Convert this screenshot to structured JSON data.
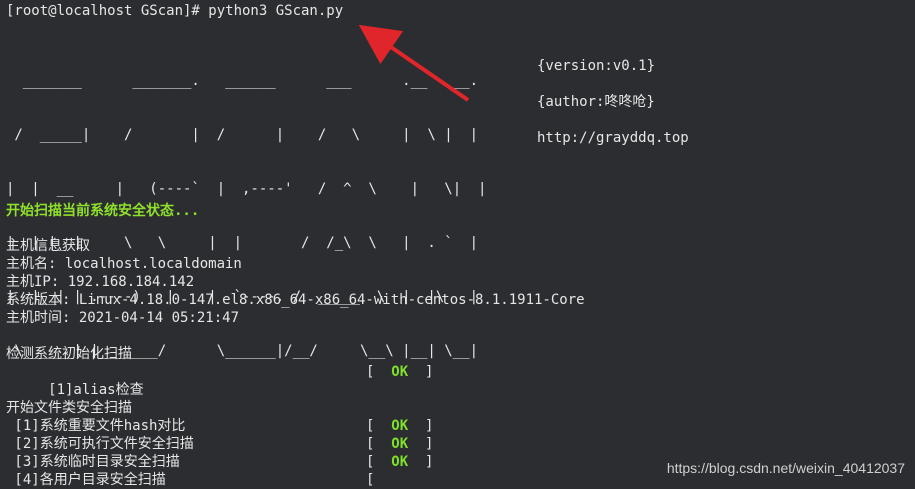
{
  "terminal": {
    "prompt": "[root@localhost GScan]# python3 GScan.py",
    "ascii_art": [
      "  _______      _______.   ______      ___      .__   __. ",
      " /  _____|    /       |  /      |    /   \\     |  \\ |  | ",
      "|  |  __     |   (----`  |  ,----'   /  ^  \\    |   \\|  | ",
      "|  | |_ |     \\   \\     |  |       /  /_\\  \\   |  . `  | ",
      "|  |__| | .----)   |    |  `----. /  _____  \\  |  |\\   | ",
      " \\______| |_______/      \\______|/__/     \\__\\ |__| \\__| "
    ],
    "version": "{version:v0.1}",
    "author": "{author:咚咚呛}",
    "website": "http://grayddq.top",
    "start_message": "开始扫描当前系统安全状态...",
    "host_section_title": "主机信息获取",
    "host_name_line": "主机名: localhost.localdomain",
    "host_ip_line": "主机IP: 192.168.184.142",
    "os_version_line": "系统版本: Linux-4.18.0-147.el8.x86_64-x86_64-with-centos-8.1.1911-Core",
    "host_time_line": "主机时间: 2021-04-14 05:21:47",
    "init_section_title": "检测系统初始化扫描",
    "init_items": [
      {
        "label": " [1]alias检查",
        "status": "OK"
      }
    ],
    "file_section_title": "开始文件类安全扫描",
    "file_items": [
      {
        "label": " [1]系统重要文件hash对比",
        "status": "OK"
      },
      {
        "label": " [2]系统可执行文件安全扫描",
        "status": "OK"
      },
      {
        "label": " [3]系统临时目录安全扫描",
        "status": "OK"
      },
      {
        "label": " [4]各用户目录安全扫描",
        "status": ""
      }
    ],
    "watermark": "https://blog.csdn.net/weixin_40412037"
  },
  "colors": {
    "background": "#2b2d31",
    "ok_green": "#7ee02b",
    "arrow_red": "#e0262a"
  }
}
